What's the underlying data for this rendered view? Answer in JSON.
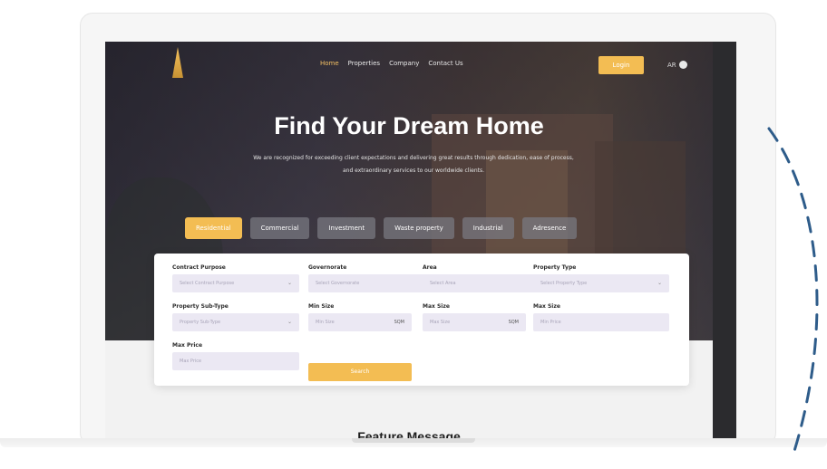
{
  "nav": {
    "items": [
      "Home",
      "Properties",
      "Company",
      "Contact Us"
    ],
    "login": "Login",
    "lang": "AR"
  },
  "hero": {
    "title": "Find Your Dream Home",
    "subtitle": "We are recognized for exceeding client expectations and delivering great results through dedication, ease of process, and extraordinary services to our worldwide clients."
  },
  "tabs": [
    "Residential",
    "Commercial",
    "Investment",
    "Waste property",
    "Industrial",
    "Adresence"
  ],
  "search": {
    "fields": [
      {
        "label": "Contract Purpose",
        "placeholder": "Select Contract Purpose",
        "suffix": "⌄"
      },
      {
        "label": "Governorate",
        "placeholder": "Select Governorate",
        "suffix": "⌄"
      },
      {
        "label": "Area",
        "placeholder": "Select Area",
        "suffix": "⌄"
      },
      {
        "label": "Property Type",
        "placeholder": "Select Property Type",
        "suffix": "⌄"
      },
      {
        "label": "Property Sub-Type",
        "placeholder": "Property Sub-Type",
        "suffix": "⌄"
      },
      {
        "label": "Min Size",
        "placeholder": "Min Size",
        "suffix": "SQM"
      },
      {
        "label": "Max Size",
        "placeholder": "Max Size",
        "suffix": "SQM"
      },
      {
        "label": "Max Size",
        "placeholder": "Min Price",
        "suffix": ""
      },
      {
        "label": "Max Price",
        "placeholder": "Max Price",
        "suffix": ""
      }
    ],
    "button": "Search"
  },
  "feature": {
    "title": "Feature Message"
  },
  "colors": {
    "accent": "#f3bd53",
    "dash": "#2e5c8a"
  }
}
